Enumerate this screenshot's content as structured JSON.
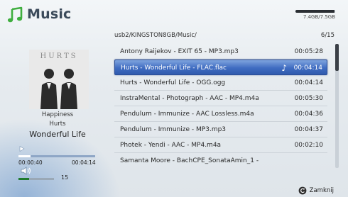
{
  "app": {
    "title": "Music",
    "brand_color": "#3fae3f"
  },
  "storage": {
    "text": "7.4GB/7.5GB",
    "used_fraction": 0.98
  },
  "browser": {
    "path": "usb2/KINGSTON8GB/Music/",
    "page_count": "6/15"
  },
  "tracks": [
    {
      "name": "Antony Raijekov - EXIT 65 - MP3.mp3",
      "duration": "00:05:28",
      "selected": false
    },
    {
      "name": "Hurts - Wonderful Life - FLAC.flac",
      "duration": "00:04:14",
      "selected": true
    },
    {
      "name": "Hurts - Wonderful Life - OGG.ogg",
      "duration": "00:04:14",
      "selected": false
    },
    {
      "name": "InstraMental - Photograph - AAC - MP4.m4a",
      "duration": "00:05:30",
      "selected": false
    },
    {
      "name": "Pendulum - Immunize - AAC Lossless.m4a",
      "duration": "00:04:36",
      "selected": false
    },
    {
      "name": "Pendulum - Immunize - MP3.mp3",
      "duration": "00:04:37",
      "selected": false
    },
    {
      "name": "Photek - Yendi - AAC - MP4.m4a",
      "duration": "00:02:10",
      "selected": false
    },
    {
      "name": "Samanta Moore - BachCPE_SonataAmin_1 -",
      "duration": "",
      "selected": false
    }
  ],
  "now_playing": {
    "album_art_text": "HURTS",
    "album": "Happiness",
    "artist": "Hurts",
    "title": "Wonderful Life",
    "elapsed": "00:00:40",
    "total": "00:04:14",
    "progress_fraction": 0.157,
    "volume": "15",
    "volume_fraction": 0.3
  },
  "footer": {
    "close_label": "Zamknij"
  },
  "icons": {
    "app": "music-note-icon",
    "play": "play-icon",
    "volume": "speaker-icon",
    "close": "back-circle-icon",
    "selected": "music-note-icon"
  }
}
